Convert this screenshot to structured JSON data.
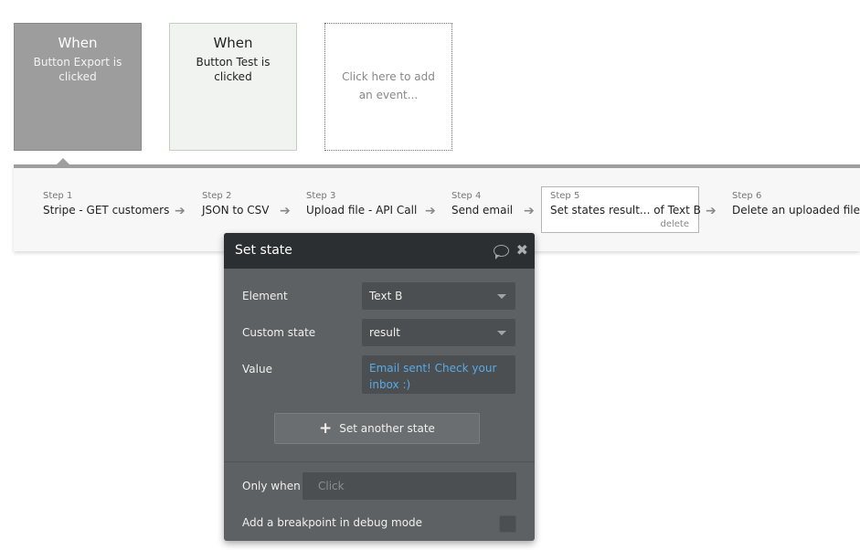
{
  "events": [
    {
      "when": "When",
      "desc": "Button Export is clicked"
    },
    {
      "when": "When",
      "desc": "Button Test is clicked"
    },
    {
      "placeholder": "Click here to add an event..."
    }
  ],
  "steps": [
    {
      "num": "Step 1",
      "title": "Stripe - GET customers"
    },
    {
      "num": "Step 2",
      "title": "JSON to CSV"
    },
    {
      "num": "Step 3",
      "title": "Upload file - API Call"
    },
    {
      "num": "Step 4",
      "title": "Send email"
    },
    {
      "num": "Step 5",
      "title": "Set states result... of Text B",
      "delete_label": "delete"
    },
    {
      "num": "Step 6",
      "title": "Delete an uploaded file"
    }
  ],
  "arrow_icon": "➔",
  "panel": {
    "title": "Set state",
    "comment_icon": "speech-bubble-icon",
    "close_icon": "✖",
    "element_label": "Element",
    "element_value": "Text B",
    "custom_state_label": "Custom state",
    "custom_state_value": "result",
    "value_label": "Value",
    "value_text": "Email sent! Check your inbox :)",
    "add_state_plus": "+",
    "add_state_label": "Set another state",
    "only_when_label": "Only when",
    "only_when_placeholder": "Click",
    "breakpoint_label": "Add a breakpoint in debug mode"
  },
  "colors": {
    "selected_event": "#9d9d9d",
    "panel_bg": "#5d6163",
    "panel_header": "#2b2f31",
    "value_link": "#5aa9e6"
  }
}
